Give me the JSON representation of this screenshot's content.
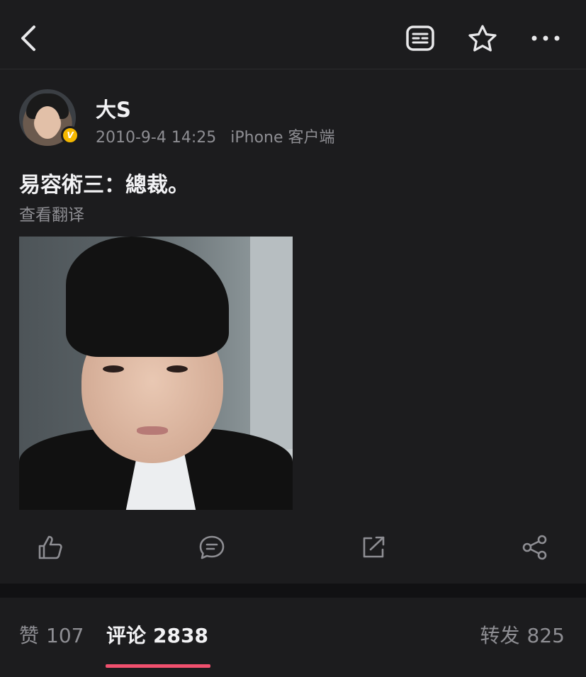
{
  "topbar": {
    "back_icon": "chevron-left-icon",
    "reader_icon": "reader-mode-icon",
    "favorite_icon": "star-icon",
    "more_icon": "more-dots-icon"
  },
  "post": {
    "author": {
      "name": "大S",
      "verified_badge": "V"
    },
    "timestamp": "2010-9-4 14:25",
    "source": "iPhone 客户端",
    "text": "易容術三：總裁。",
    "translate_label": "查看翻译",
    "actions": {
      "like_icon": "thumbs-up-icon",
      "comment_icon": "comment-icon",
      "repost_icon": "repost-icon",
      "share_icon": "share-icon"
    }
  },
  "tabs": {
    "likes": {
      "label": "赞",
      "count": "107"
    },
    "comments": {
      "label": "评论",
      "count": "2838"
    },
    "reposts": {
      "label": "转发",
      "count": "825"
    }
  },
  "colors": {
    "background": "#1c1c1e",
    "accent_underline": "#f0506e",
    "verified_badge": "#f5b800",
    "secondary_text": "#8e8e93"
  }
}
